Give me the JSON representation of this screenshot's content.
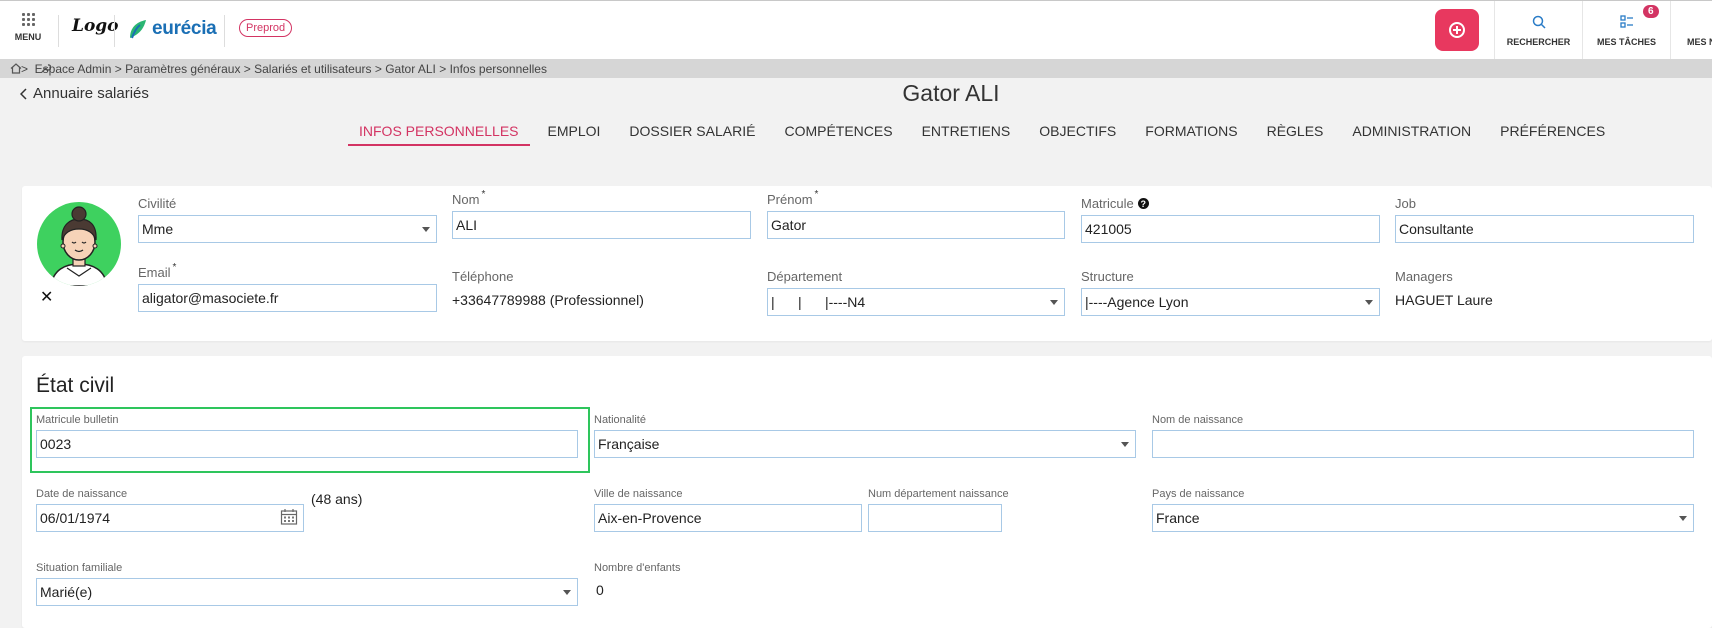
{
  "topbar": {
    "menu_label": "MENU",
    "logo_label": "Logo",
    "brand_name": "eurécia",
    "env_badge": "Preprod",
    "actions": {
      "search_label": "RECHERCHER",
      "tasks_label": "MES TÂCHES",
      "tasks_count": "6",
      "more_label": "MES N"
    }
  },
  "breadcrumb": ">  Espace Admin > Paramètres généraux > Salariés et utilisateurs > Gator ALI > Infos personnelles",
  "header": {
    "back_label": "Annuaire salariés",
    "title": "Gator ALI"
  },
  "tabs": [
    {
      "label": "INFOS PERSONNELLES",
      "active": true
    },
    {
      "label": "EMPLOI"
    },
    {
      "label": "DOSSIER SALARIÉ"
    },
    {
      "label": "COMPÉTENCES"
    },
    {
      "label": "ENTRETIENS"
    },
    {
      "label": "OBJECTIFS"
    },
    {
      "label": "FORMATIONS"
    },
    {
      "label": "RÈGLES"
    },
    {
      "label": "ADMINISTRATION"
    },
    {
      "label": "PRÉFÉRENCES"
    }
  ],
  "identity": {
    "civilite": {
      "label": "Civilité",
      "value": "Mme"
    },
    "nom": {
      "label": "Nom",
      "value": "ALI"
    },
    "prenom": {
      "label": "Prénom",
      "value": "Gator"
    },
    "matricule": {
      "label": "Matricule",
      "value": "421005"
    },
    "job": {
      "label": "Job",
      "value": "Consultante"
    },
    "email": {
      "label": "Email",
      "value": "aligator@masociete.fr"
    },
    "telephone": {
      "label": "Téléphone",
      "value": "+33647789988 (Professionnel)"
    },
    "departement": {
      "label": "Département",
      "value": "|      |      |----N4"
    },
    "structure": {
      "label": "Structure",
      "value": "|----Agence Lyon"
    },
    "managers": {
      "label": "Managers",
      "value": "HAGUET Laure"
    },
    "required_mark": "*"
  },
  "etat_civil": {
    "title": "État civil",
    "matricule_bulletin": {
      "label": "Matricule bulletin",
      "value": "0023"
    },
    "nationalite": {
      "label": "Nationalité",
      "value": "Française"
    },
    "nom_naissance": {
      "label": "Nom de naissance",
      "value": ""
    },
    "date_naissance": {
      "label": "Date de naissance",
      "value": "06/01/1974",
      "age": "(48 ans)"
    },
    "ville_naissance": {
      "label": "Ville de naissance",
      "value": "Aix-en-Provence"
    },
    "num_dept_naissance": {
      "label": "Num département naissance",
      "value": ""
    },
    "pays_naissance": {
      "label": "Pays de naissance",
      "value": "France"
    },
    "situation_familiale": {
      "label": "Situation familiale",
      "value": "Marié(e)"
    },
    "nombre_enfants": {
      "label": "Nombre d'enfants",
      "value": "0"
    }
  },
  "colors": {
    "accent": "#d33463",
    "brand": "#1a6fb5",
    "highlight": "#2ec55c",
    "avatar_bg": "#3ed15f"
  }
}
